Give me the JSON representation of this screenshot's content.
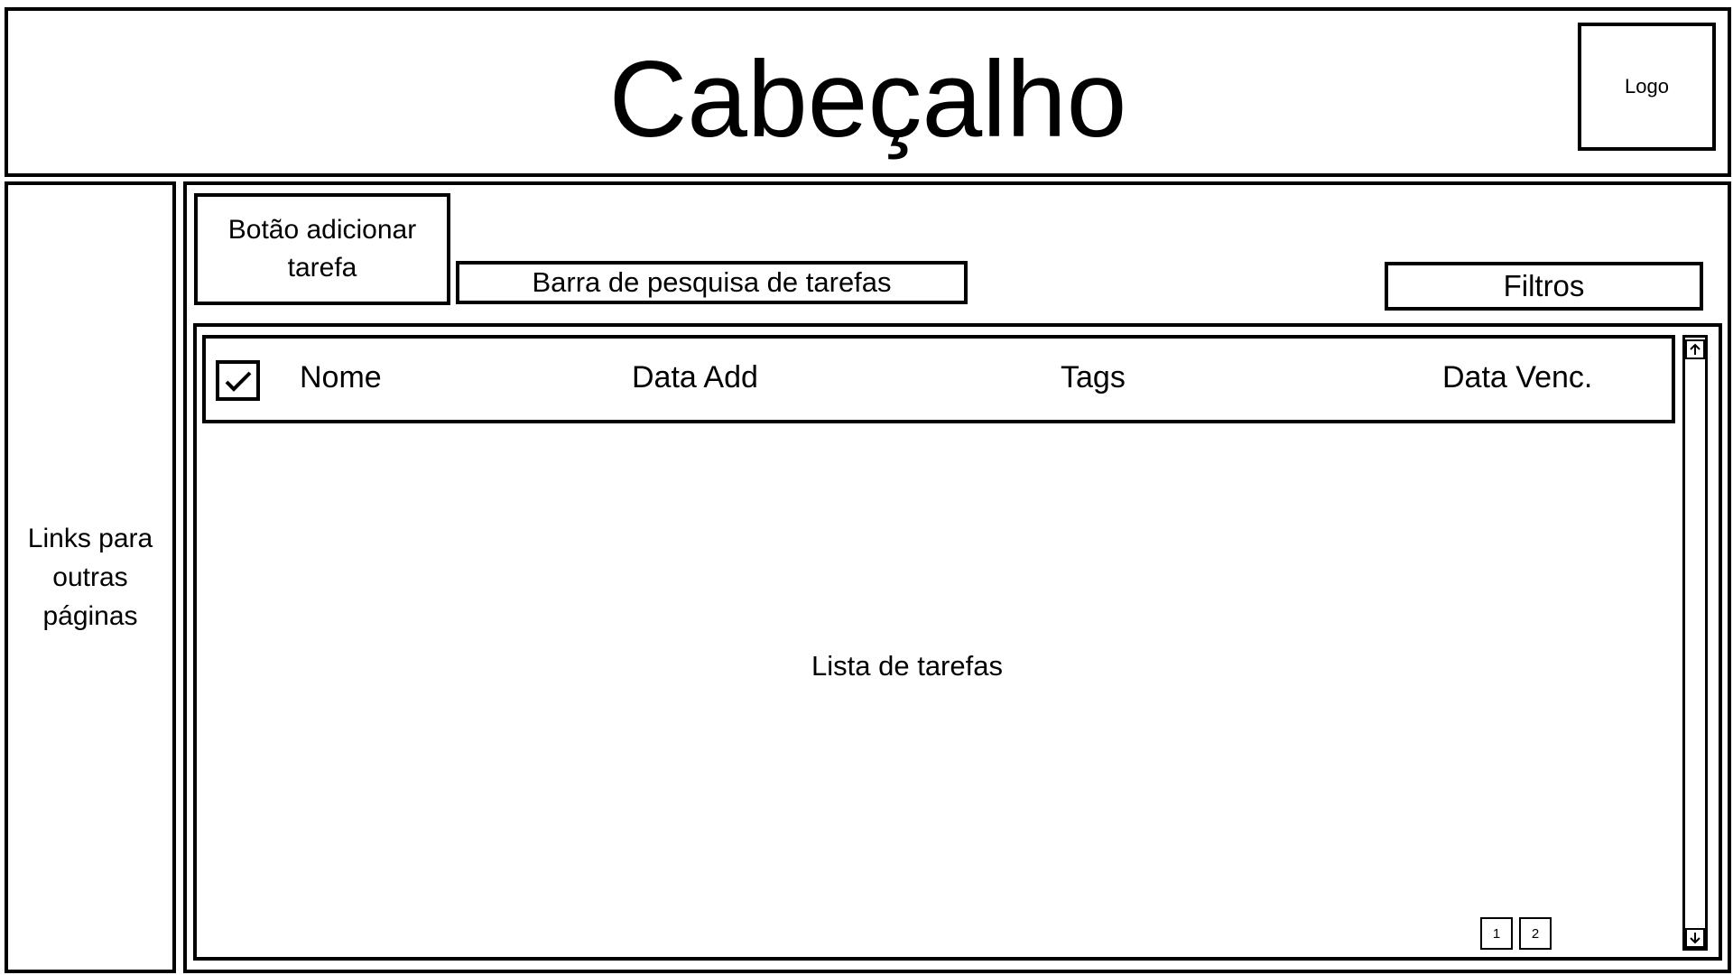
{
  "header": {
    "title": "Cabeçalho",
    "logo_label": "Logo"
  },
  "sidebar": {
    "text": "Links para outras páginas"
  },
  "toolbar": {
    "add_task_label": "Botão adicionar tarefa",
    "search_label": "Barra de pesquisa de tarefas",
    "filters_label": "Filtros"
  },
  "task_table": {
    "columns": [
      "Nome",
      "Data Add",
      "Tags",
      "Data Venc."
    ],
    "placeholder": "Lista de tarefas"
  },
  "pagination": {
    "pages": [
      "1",
      "2"
    ]
  },
  "icons": {
    "select_all": "check-icon",
    "scroll_up": "arrow-up-icon",
    "scroll_down": "arrow-down-icon"
  }
}
